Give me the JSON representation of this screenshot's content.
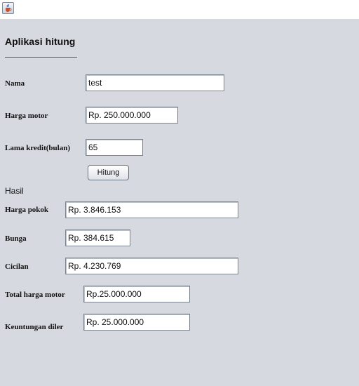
{
  "window": {
    "icon": "java-cup-icon"
  },
  "app": {
    "title": "Aplikasi hitung"
  },
  "form": {
    "nama": {
      "label": "Nama",
      "value": "test"
    },
    "harga_motor": {
      "label": "Harga motor",
      "value": "Rp. 250.000.000"
    },
    "lama_kredit": {
      "label": "Lama kredit(bulan)",
      "value": "65"
    },
    "hitung_label": "Hitung"
  },
  "hasil": {
    "title": "Hasil",
    "harga_pokok": {
      "label": "Harga pokok",
      "value": "Rp. 3.846.153"
    },
    "bunga": {
      "label": "Bunga",
      "value": "Rp. 384.615"
    },
    "cicilan": {
      "label": "Cicilan",
      "value": "Rp. 4.230.769"
    },
    "total_harga_motor": {
      "label": "Total harga motor",
      "value": "Rp.25.000.000"
    },
    "keuntungan_diler": {
      "label": "Keuntungan diler",
      "value": "Rp. 25.000.000"
    }
  }
}
